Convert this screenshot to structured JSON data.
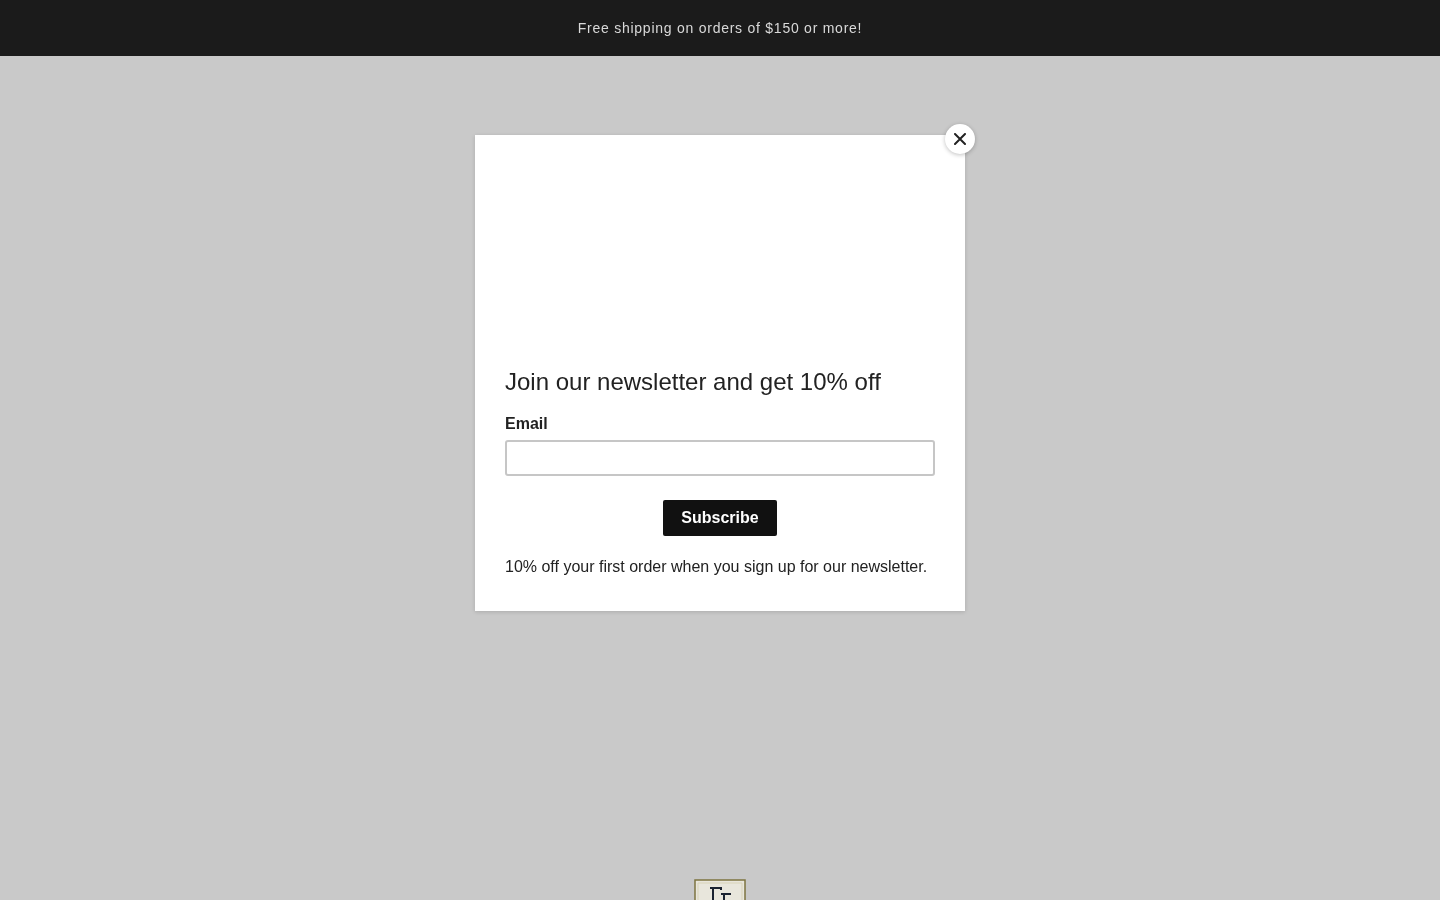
{
  "announcement_bar": {
    "text": "Free shipping on orders of $150 or more!"
  },
  "popup": {
    "heading": "Join our newsletter and get 10% off",
    "email_field": {
      "label": "Email"
    },
    "subscribe_button": "Subscribe",
    "note": "10% off your first order when you sign up for our newsletter."
  }
}
